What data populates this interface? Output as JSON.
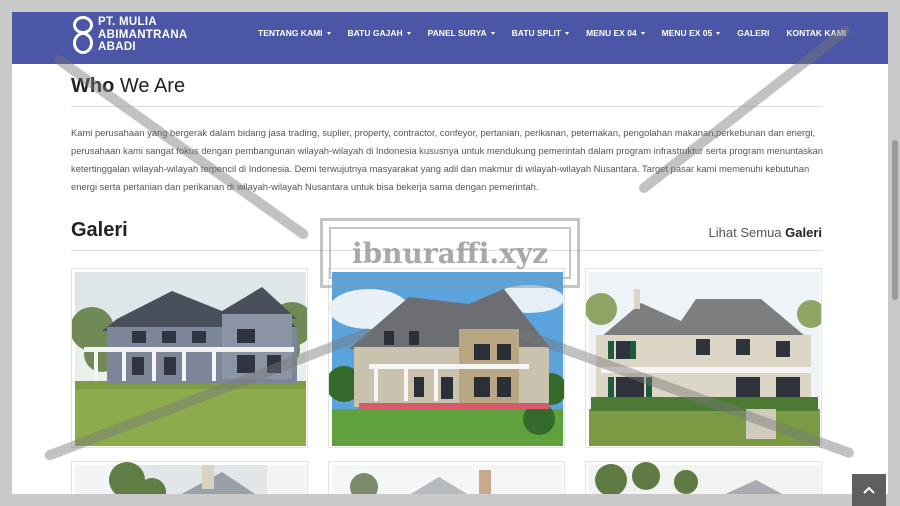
{
  "brand": {
    "line1": "PT. MULIA",
    "line2": "ABIMANTRANA",
    "line3": "ABADI"
  },
  "nav": {
    "items": [
      {
        "label": "TENTANG KAMI",
        "dropdown": true
      },
      {
        "label": "BATU GAJAH",
        "dropdown": true
      },
      {
        "label": "PANEL SURYA",
        "dropdown": true
      },
      {
        "label": "BATU SPLIT",
        "dropdown": true
      },
      {
        "label": "MENU EX 04",
        "dropdown": true
      },
      {
        "label": "MENU EX 05",
        "dropdown": true
      },
      {
        "label": "GALERI",
        "dropdown": false
      },
      {
        "label": "KONTAK KAMI",
        "dropdown": false
      }
    ]
  },
  "about": {
    "title_bold": "Who",
    "title_rest": " We Are",
    "text": "Kami perusahaan yang bergerak dalam bidang jasa trading, suplier, property, contractor, confeyor, pertanian, perikanan, peternakan, pengolahan makanan,perkebunan dan energi, perusahaan kami sangat fokus dengan pembangunan wilayah-wilayah di Indonesia kususnya untuk mendukung pemerintah dalam program infrastruktur serta program menuntaskan ketertinggalan wilayah-wilayah terpencil di Indonesia. Demi terwujutnya masyarakat yang adil dan makmur di wilayah-wilayah Nusantara. Target pasar kami memenuhi kebutuhan energi serta pertanian dan perikanan di wilayah-wilayah Nusantara untuk bisa bekerja sama dengan pemerintah."
  },
  "gallery": {
    "title": "Galeri",
    "see_all_prefix": "Lihat Semua ",
    "see_all_bold": "Galeri"
  },
  "watermark": "ibnuraffi.xyz",
  "colors": {
    "navbar": "#4b56a6",
    "text": "#555555"
  },
  "icons": {
    "back_to_top": "chevron-up-icon"
  }
}
